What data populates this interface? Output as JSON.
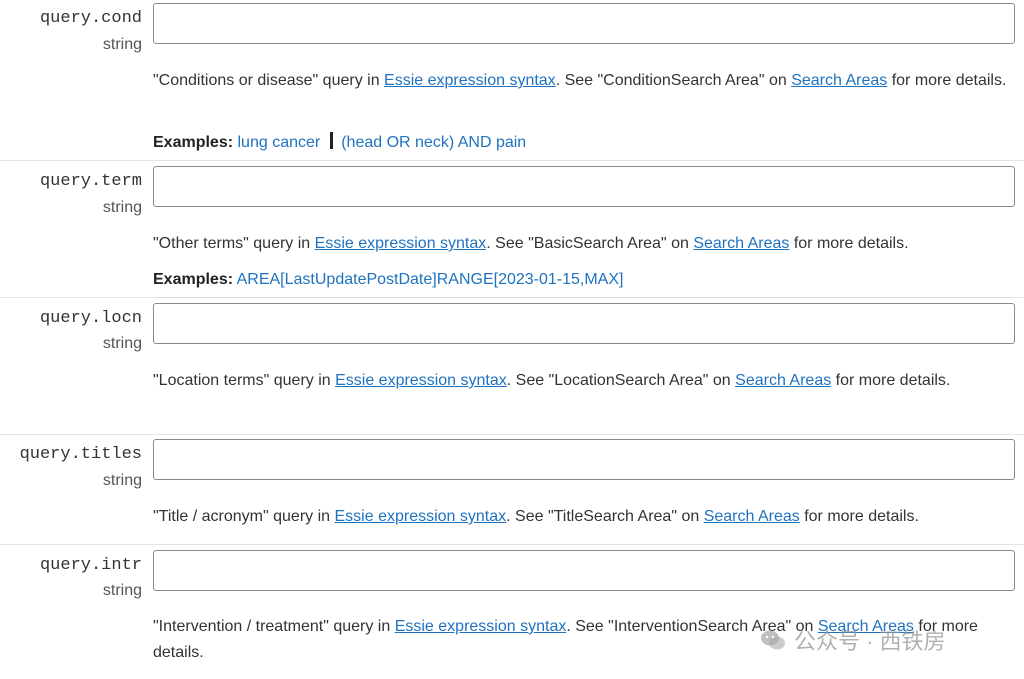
{
  "params": [
    {
      "name": "query.cond",
      "type": "string",
      "value": "",
      "desc": [
        {
          "t": "text",
          "v": "\"Conditions or disease\" query in "
        },
        {
          "t": "link",
          "v": "Essie expression syntax"
        },
        {
          "t": "text",
          "v": ". See \"ConditionSearch Area\" on "
        },
        {
          "t": "link",
          "v": "Search Areas"
        },
        {
          "t": "text",
          "v": " for more details."
        }
      ],
      "examples_label": "Examples:",
      "examples": [
        "lung cancer",
        "(head OR neck) AND pain"
      ]
    },
    {
      "name": "query.term",
      "type": "string",
      "value": "",
      "desc": [
        {
          "t": "text",
          "v": "\"Other terms\" query in "
        },
        {
          "t": "link",
          "v": "Essie expression syntax"
        },
        {
          "t": "text",
          "v": ". See \"BasicSearch Area\" on "
        },
        {
          "t": "link",
          "v": "Search Areas"
        },
        {
          "t": "text",
          "v": " for more details."
        }
      ],
      "examples_label": "Examples:",
      "examples": [
        "AREA[LastUpdatePostDate]RANGE[2023-01-15,MAX]"
      ]
    },
    {
      "name": "query.locn",
      "type": "string",
      "value": "",
      "desc": [
        {
          "t": "text",
          "v": "\"Location terms\" query in "
        },
        {
          "t": "link",
          "v": "Essie expression syntax"
        },
        {
          "t": "text",
          "v": ". See \"LocationSearch Area\" on "
        },
        {
          "t": "link",
          "v": "Search Areas"
        },
        {
          "t": "text",
          "v": " for more details."
        }
      ],
      "examples_label": "",
      "examples": []
    },
    {
      "name": "query.titles",
      "type": "string",
      "value": "",
      "desc": [
        {
          "t": "text",
          "v": "\"Title / acronym\" query in "
        },
        {
          "t": "link",
          "v": "Essie expression syntax"
        },
        {
          "t": "text",
          "v": ". See \"TitleSearch Area\" on "
        },
        {
          "t": "link",
          "v": "Search Areas"
        },
        {
          "t": "text",
          "v": " for more details."
        }
      ],
      "examples_label": "",
      "examples": []
    },
    {
      "name": "query.intr",
      "type": "string",
      "value": "",
      "desc": [
        {
          "t": "text",
          "v": "\"Intervention / treatment\" query in "
        },
        {
          "t": "link",
          "v": "Essie expression syntax"
        },
        {
          "t": "text",
          "v": ". See \"InterventionSearch Area\" on "
        },
        {
          "t": "link",
          "v": "Search Areas"
        },
        {
          "t": "text",
          "v": " for more details."
        }
      ],
      "examples_label": "",
      "examples": []
    }
  ],
  "watermark": {
    "text": "公众号 · 西铁房",
    "icon": "wechat-icon"
  }
}
